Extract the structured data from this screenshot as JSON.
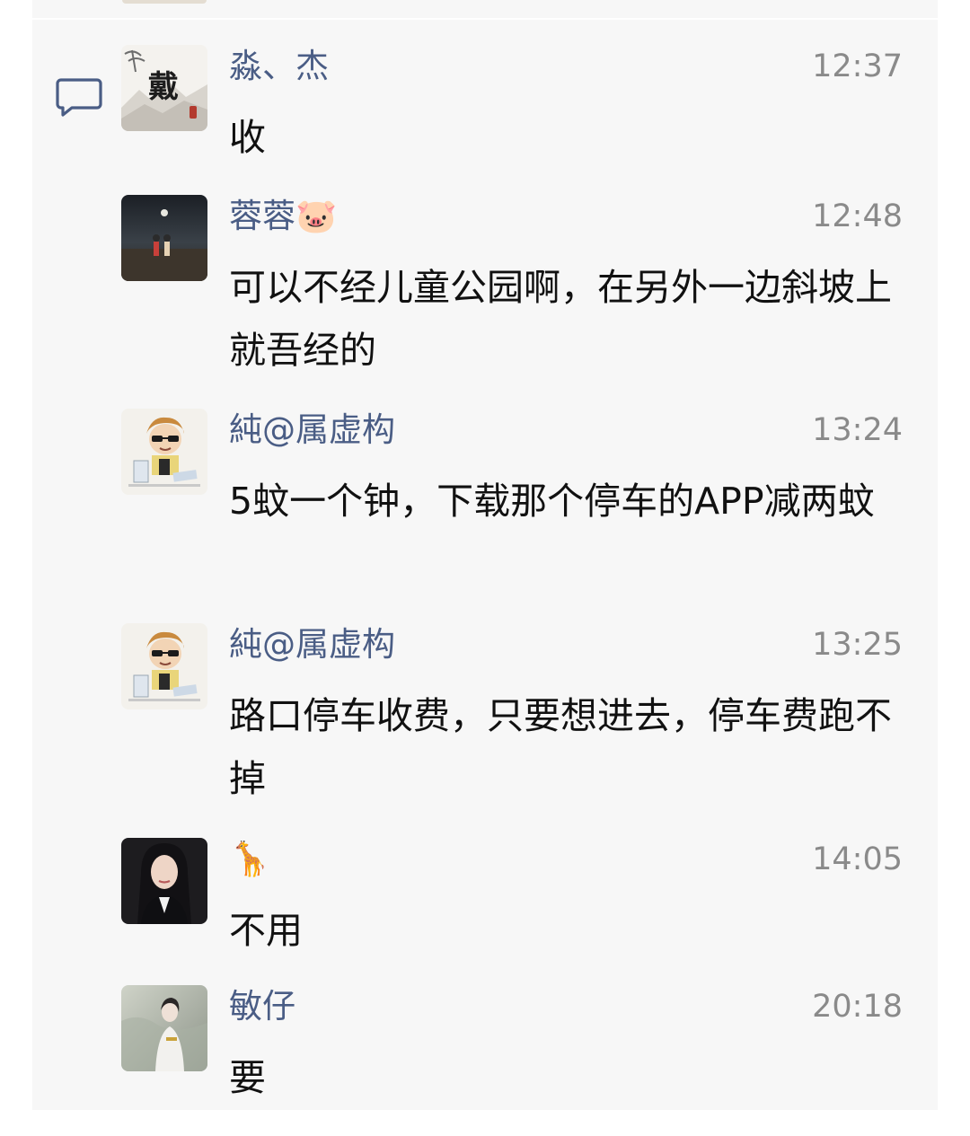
{
  "messages": [
    {
      "name": "淼、杰",
      "time": "12:37",
      "text": "收",
      "avatar_icon": "ink-painting-avatar"
    },
    {
      "name": "蓉蓉🐷",
      "time": "12:48",
      "text": "可以不经儿童公园啊，在另外一边斜坡上就吾经的",
      "avatar_icon": "night-beach-avatar"
    },
    {
      "name": "純@属虚构",
      "time": "13:24",
      "text": "5蚊一个钟，下载那个停车的APP减两蚊",
      "avatar_icon": "cartoon-boy-avatar"
    },
    {
      "name": "純@属虚构",
      "time": "13:25",
      "text": "路口停车收费，只要想进去，停车费跑不掉",
      "avatar_icon": "cartoon-boy-avatar"
    },
    {
      "name": "🦒",
      "time": "14:05",
      "text": "不用",
      "avatar_icon": "woman-portrait-avatar"
    },
    {
      "name": "敏仔",
      "time": "20:18",
      "text": "要",
      "avatar_icon": "woman-hanfu-avatar"
    }
  ],
  "colors": {
    "name": "#4a5d85",
    "time": "#8a8a8a",
    "text": "#111111",
    "panel": "#f7f7f7",
    "icon": "#4a5d85"
  },
  "icons": {
    "comment": "comment-icon"
  }
}
